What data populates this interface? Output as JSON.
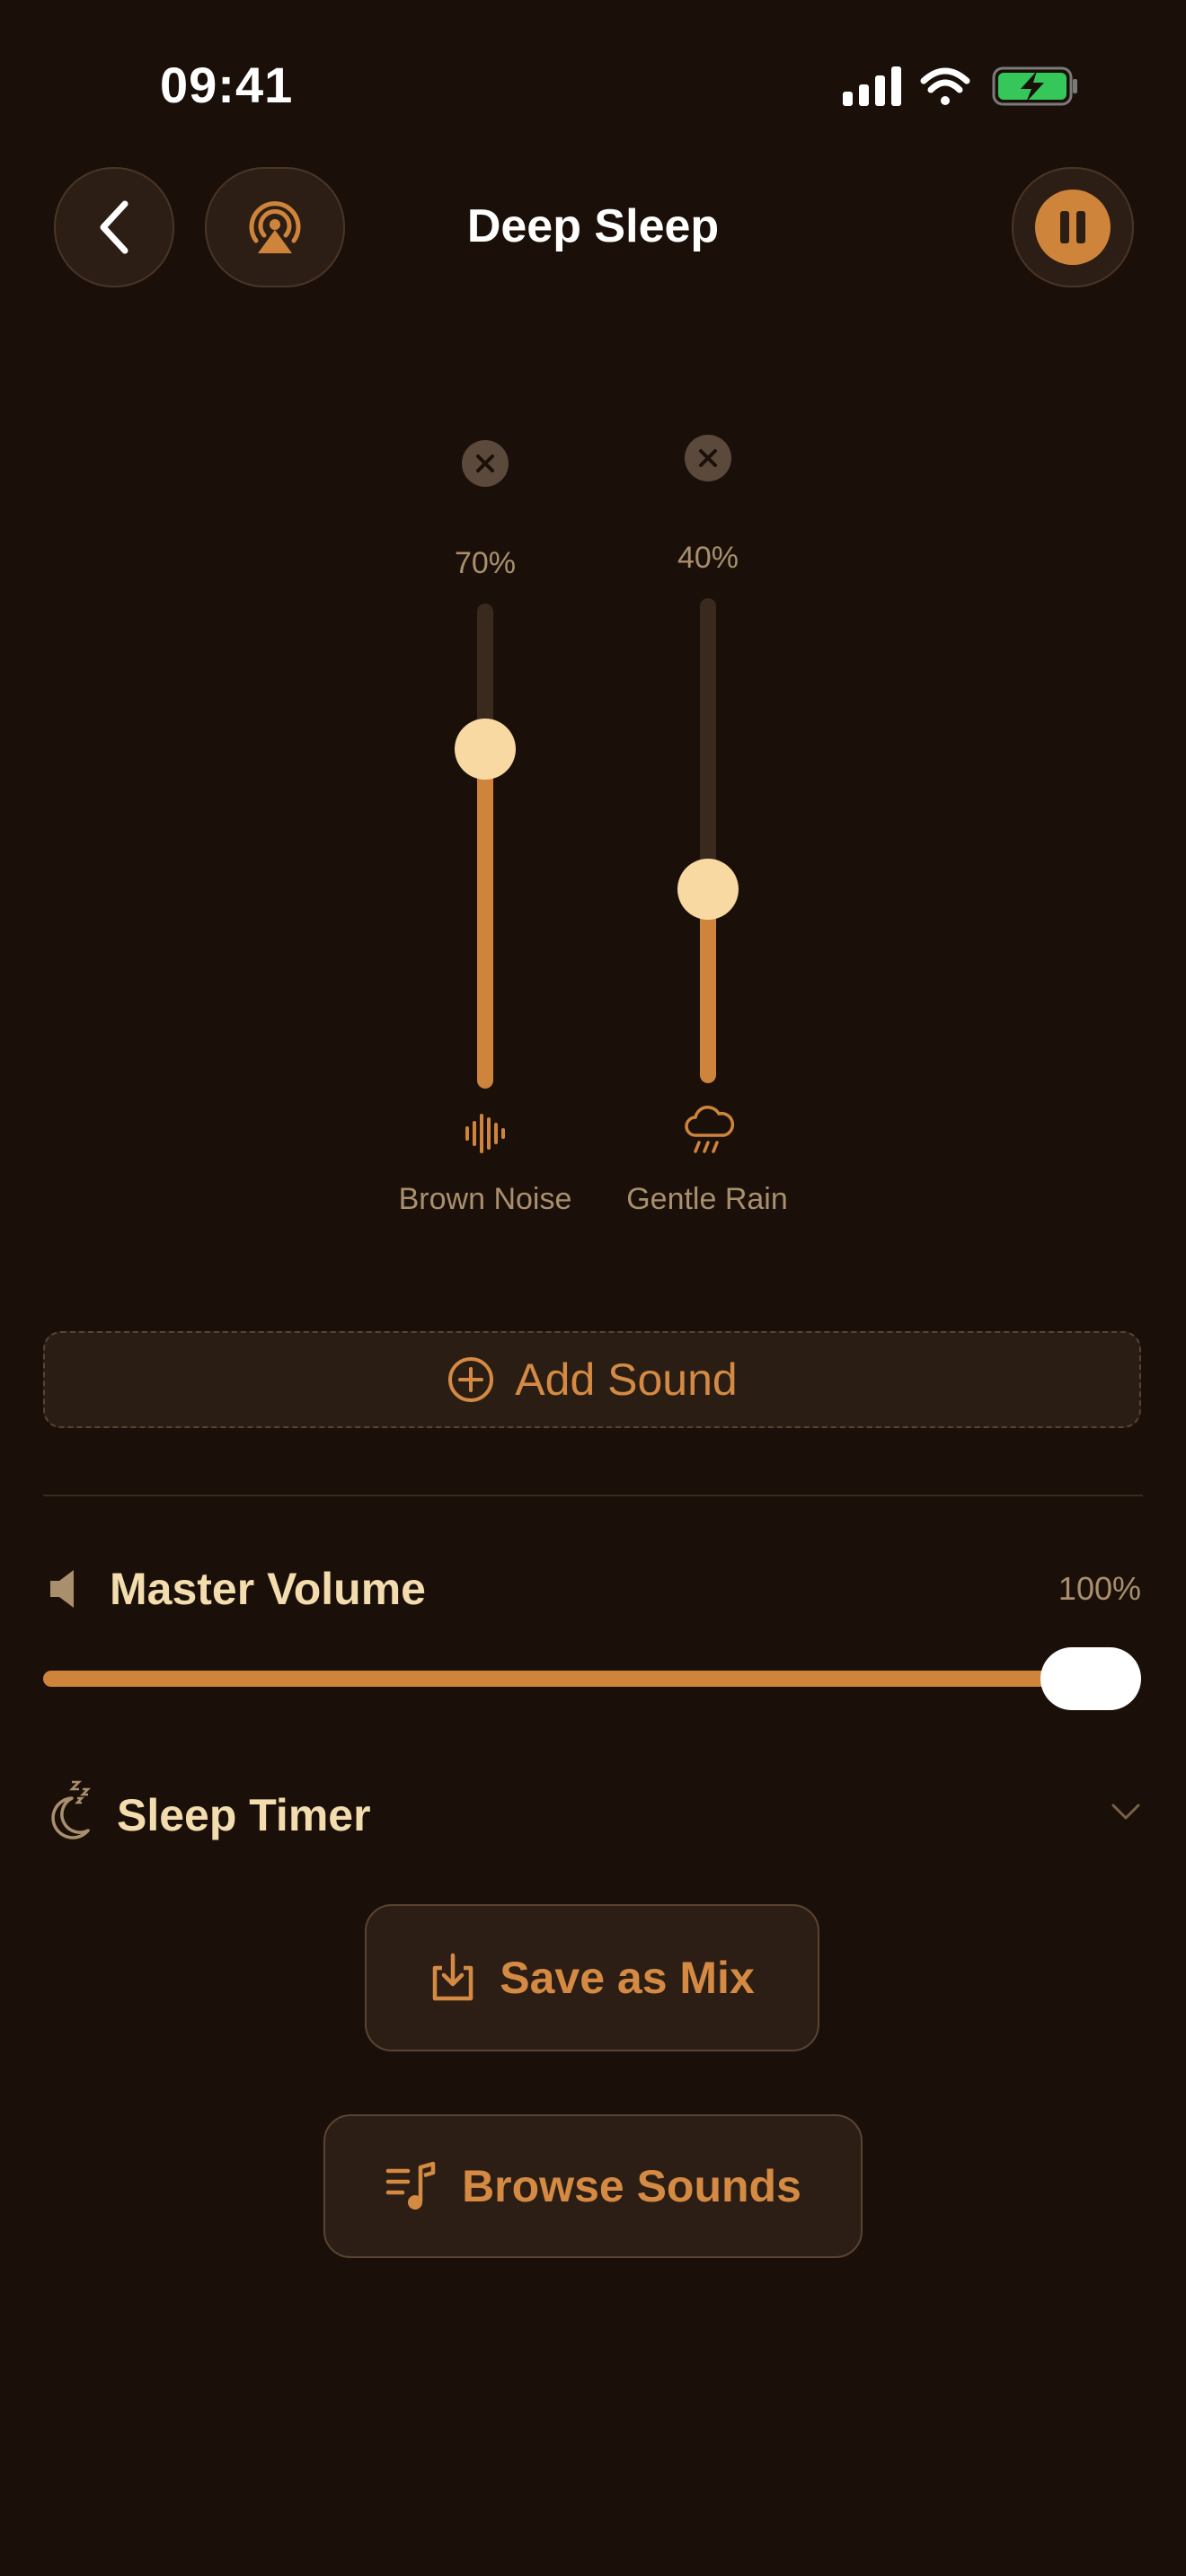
{
  "status_bar": {
    "time": "09:41"
  },
  "header": {
    "title": "Deep Sleep"
  },
  "sounds": [
    {
      "name": "Brown Noise",
      "volume_label": "70%",
      "volume": 0.7,
      "icon": "waveform-icon"
    },
    {
      "name": "Gentle Rain",
      "volume_label": "40%",
      "volume": 0.4,
      "icon": "rain-cloud-icon"
    }
  ],
  "add_sound": {
    "label": "Add Sound"
  },
  "master_volume": {
    "label": "Master Volume",
    "value_label": "100%",
    "value": 1.0
  },
  "sleep_timer": {
    "label": "Sleep Timer"
  },
  "actions": {
    "save_label": "Save as Mix",
    "browse_label": "Browse Sounds"
  },
  "colors": {
    "background": "#1a1009",
    "accent": "#cf843c",
    "thumb": "#f7d9a1",
    "text": "#f3dcae",
    "muted": "#a98f6d"
  }
}
